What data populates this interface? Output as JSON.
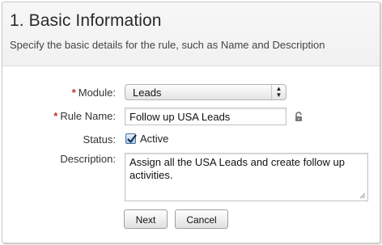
{
  "header": {
    "title": "1. Basic Information",
    "subtitle": "Specify the basic details for the rule, such as Name and Description"
  },
  "form": {
    "module": {
      "required_mark": "*",
      "label": "Module:",
      "selected_value": "Leads",
      "icon": "up-down-arrows-icon"
    },
    "rule_name": {
      "required_mark": "*",
      "label": "Rule Name:",
      "value": "Follow up USA Leads",
      "icon": "lock-icon"
    },
    "status": {
      "label": "Status:",
      "checkbox_checked": true,
      "checkbox_label": "Active"
    },
    "description": {
      "label": "Description:",
      "value": "Assign all the USA Leads and create follow up activities."
    }
  },
  "actions": {
    "next_label": "Next",
    "cancel_label": "Cancel"
  },
  "colors": {
    "required": "#c4302b",
    "header_bg": "#f4f4f4",
    "checkbox_fill": "#a8c8e9"
  }
}
